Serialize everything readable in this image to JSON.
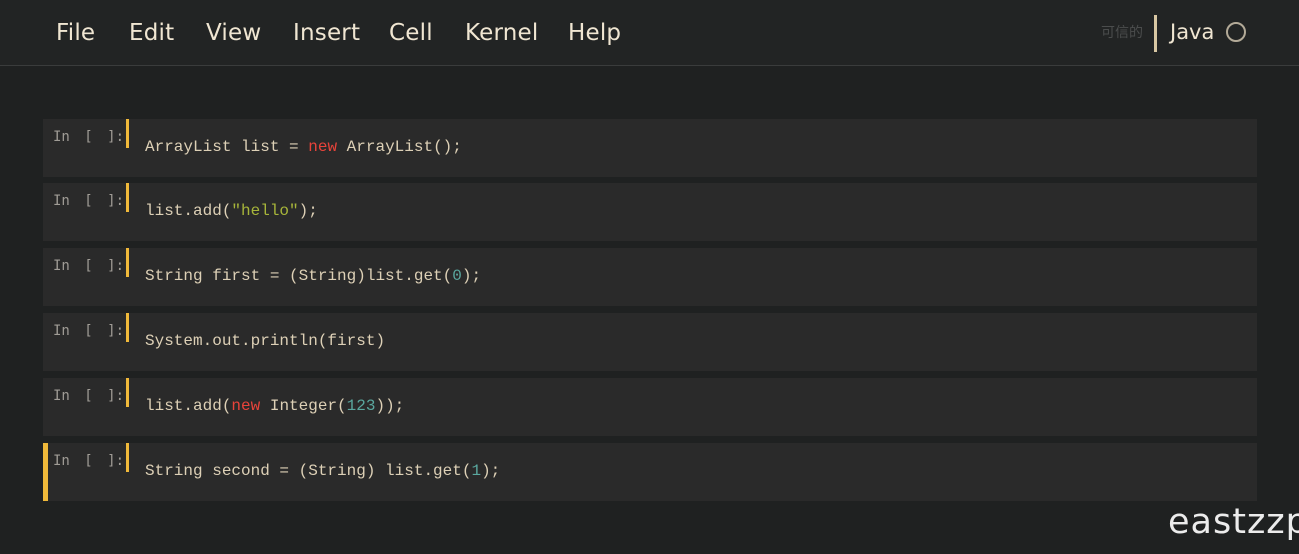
{
  "menu": {
    "items": [
      "File",
      "Edit",
      "View",
      "Insert",
      "Cell",
      "Kernel",
      "Help"
    ]
  },
  "status": {
    "trusted": "可信的",
    "kernel_name": "Java",
    "kernel_state": "idle"
  },
  "cells": [
    {
      "prompt": "In [ ]:",
      "code": "ArrayList list = new ArrayList();",
      "tokens": [
        {
          "t": "ArrayList list ",
          "c": ""
        },
        {
          "t": "=",
          "c": ""
        },
        {
          "t": " ",
          "c": ""
        },
        {
          "t": "new",
          "c": "kw"
        },
        {
          "t": " ArrayList();",
          "c": ""
        }
      ]
    },
    {
      "prompt": "In [ ]:",
      "code": "list.add(\"hello\");",
      "tokens": [
        {
          "t": "list.add(",
          "c": ""
        },
        {
          "t": "\"hello\"",
          "c": "str"
        },
        {
          "t": ");",
          "c": ""
        }
      ]
    },
    {
      "prompt": "In [ ]:",
      "code": "String first = (String)list.get(0);",
      "tokens": [
        {
          "t": "String first = (String)list.get(",
          "c": ""
        },
        {
          "t": "0",
          "c": "num"
        },
        {
          "t": ");",
          "c": ""
        }
      ]
    },
    {
      "prompt": "In [ ]:",
      "code": "System.out.println(first)",
      "tokens": [
        {
          "t": "System.out.println(first)",
          "c": ""
        }
      ]
    },
    {
      "prompt": "In [ ]:",
      "code": "list.add(new Integer(123));",
      "tokens": [
        {
          "t": "list.add(",
          "c": ""
        },
        {
          "t": "new",
          "c": "kw"
        },
        {
          "t": " Integer(",
          "c": ""
        },
        {
          "t": "123",
          "c": "num"
        },
        {
          "t": "));",
          "c": ""
        }
      ]
    },
    {
      "prompt": "In [ ]:",
      "code": "String second = (String) list.get(1);",
      "selected": true,
      "tokens": [
        {
          "t": "String second = (String) list.get(",
          "c": ""
        },
        {
          "t": "1",
          "c": "num"
        },
        {
          "t": ");",
          "c": ""
        }
      ]
    }
  ],
  "watermark": "eastzzp",
  "colors": {
    "background": "#1f2121",
    "cell_background": "#2a2a2a",
    "accent": "#f0b93a",
    "keyword": "#e8433a",
    "string": "#a7b53a",
    "number": "#5aa89f",
    "text": "#ddd0b6"
  }
}
